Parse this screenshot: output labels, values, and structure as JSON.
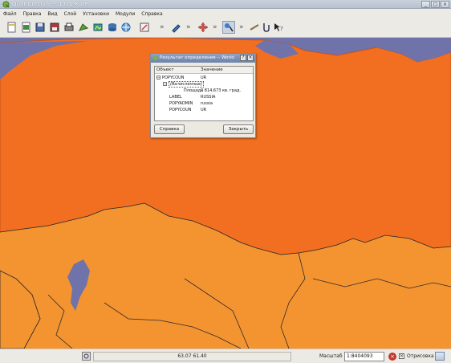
{
  "window": {
    "title": "Quantum GIS -- 1.0.1-Kore",
    "controls": [
      "_",
      "□",
      "×"
    ]
  },
  "menu": {
    "items": [
      "Файл",
      "Правка",
      "Вид",
      "Слой",
      "Установки",
      "Модули",
      "Справка"
    ]
  },
  "toolbar": {
    "overflow_glyph": "»"
  },
  "identify_dialog": {
    "title": "Результат определения -- World",
    "help_button": "?",
    "close_button": "×",
    "columns": {
      "object": "Объект",
      "value": "Значение"
    },
    "rows": [
      {
        "key": "POPYCOUN",
        "value": "UR",
        "level": 0,
        "expander": "−"
      },
      {
        "key": "(Вычисленные)",
        "value": "",
        "level": 1,
        "expander": "−"
      },
      {
        "key": "Площадь",
        "value": "2 814,673 кв. град.",
        "level": 2,
        "expander": ""
      },
      {
        "key": "LABEL",
        "value": "RUSSIA",
        "level": 1,
        "expander": ""
      },
      {
        "key": "POPYADMIN",
        "value": "russia",
        "level": 1,
        "expander": ""
      },
      {
        "key": "POPYCOUN",
        "value": "UR",
        "level": 1,
        "expander": ""
      }
    ],
    "help_label": "Справка",
    "close_label": "Закрыть"
  },
  "statusbar": {
    "coordinates": "63.07 61.40",
    "scale_label": "Масштаб",
    "scale_value": "1:8404093",
    "render_check": "✕",
    "render_label": "Отрисовка"
  },
  "colors": {
    "water": "#6f73a9",
    "russia": "#f26f22",
    "neighbors": "#f49431",
    "border": "#2b2b2b"
  }
}
